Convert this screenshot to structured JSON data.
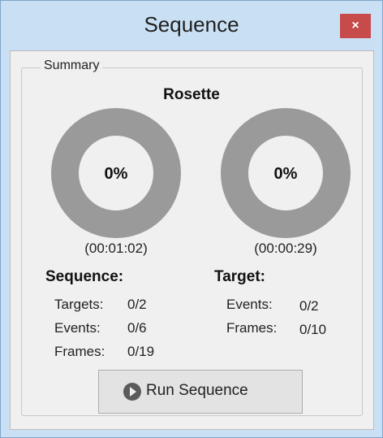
{
  "window": {
    "title": "Sequence",
    "close_label": "×"
  },
  "summary": {
    "group_label": "Summary",
    "rosette_title": "Rosette",
    "sequence_progress": {
      "text": "0%",
      "fraction": 0.0,
      "time": "(00:01:02)"
    },
    "target_progress": {
      "text": "0%",
      "fraction": 0.0,
      "time": "(00:00:29)"
    },
    "sequence": {
      "heading": "Sequence:",
      "targets_label": "Targets:",
      "targets_value": "0/2",
      "events_label": "Events:",
      "events_value": "0/6",
      "frames_label": "Frames:",
      "frames_value": "0/19"
    },
    "target": {
      "heading": "Target:",
      "events_label": "Events:",
      "events_value": "0/2",
      "frames_label": "Frames:",
      "frames_value": "0/10"
    }
  },
  "run_button": {
    "label": "Run Sequence",
    "icon": "play-circle-icon"
  },
  "colors": {
    "ring_track": "#9a9a9a",
    "ring_fill": "#3a8ee6",
    "close_button": "#c74b4b",
    "frame": "#c9e0f4"
  }
}
